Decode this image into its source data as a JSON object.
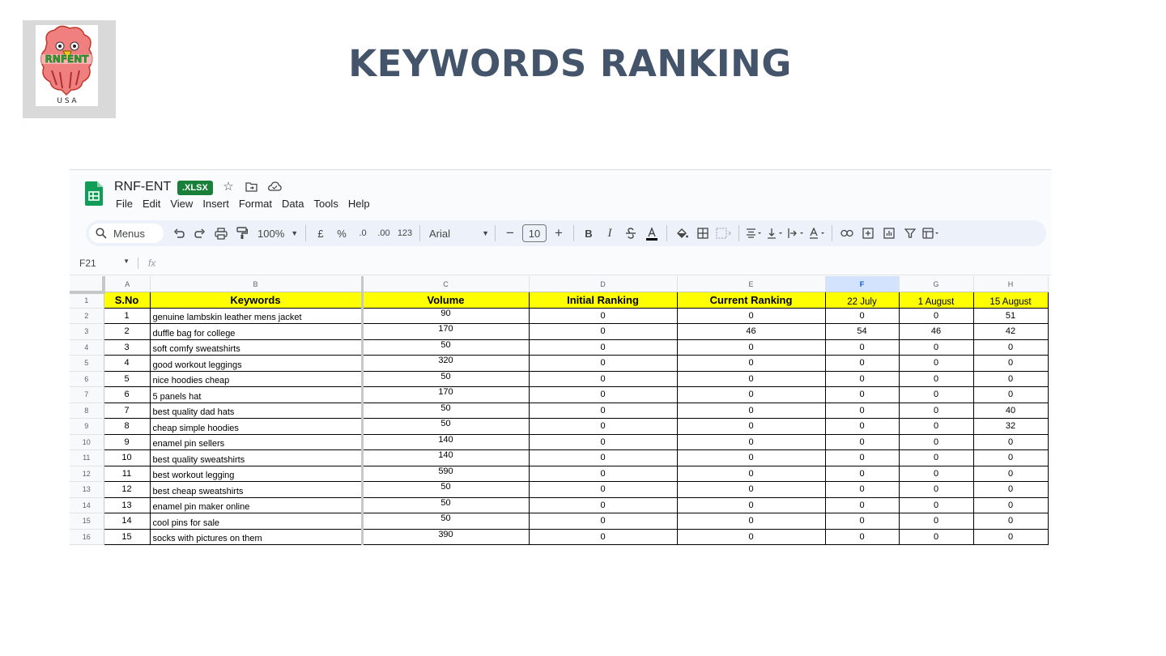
{
  "slide": {
    "title": "KEYWORDS RANKING",
    "logo": {
      "name": "RNFENT",
      "sub": "U S A"
    }
  },
  "app": {
    "doc_title": "RNF-ENT",
    "badge": ".XLSX",
    "menus": [
      "File",
      "Edit",
      "View",
      "Insert",
      "Format",
      "Data",
      "Tools",
      "Help"
    ],
    "toolbar": {
      "search_label": "Menus",
      "zoom": "100%",
      "currency": "£",
      "percent": "%",
      "dec_less": ".0",
      "dec_more": ".00",
      "number_format": "123",
      "font": "Arial",
      "font_size": "10",
      "bold": "B",
      "italic": "I"
    },
    "name_box": "F21",
    "fx_label": "fx"
  },
  "sheet": {
    "col_letters": [
      "A",
      "B",
      "C",
      "D",
      "E",
      "F",
      "G",
      "H"
    ],
    "selected_col": "F",
    "headers": [
      "S.No",
      "Keywords",
      "Volume",
      "Initial Ranking",
      "Current Ranking",
      "22 July",
      "1 August",
      "15 August"
    ],
    "rows": [
      [
        "1",
        "genuine lambskin leather mens jacket",
        "90",
        "0",
        "0",
        "0",
        "0",
        "51"
      ],
      [
        "2",
        "duffle bag for college",
        "170",
        "0",
        "46",
        "54",
        "46",
        "42"
      ],
      [
        "3",
        "soft comfy sweatshirts",
        "50",
        "0",
        "0",
        "0",
        "0",
        "0"
      ],
      [
        "4",
        "good workout leggings",
        "320",
        "0",
        "0",
        "0",
        "0",
        "0"
      ],
      [
        "5",
        "nice hoodies cheap",
        "50",
        "0",
        "0",
        "0",
        "0",
        "0"
      ],
      [
        "6",
        "5 panels hat",
        "170",
        "0",
        "0",
        "0",
        "0",
        "0"
      ],
      [
        "7",
        "best quality dad hats",
        "50",
        "0",
        "0",
        "0",
        "0",
        "40"
      ],
      [
        "8",
        "cheap simple hoodies",
        "50",
        "0",
        "0",
        "0",
        "0",
        "32"
      ],
      [
        "9",
        "enamel pin sellers",
        "140",
        "0",
        "0",
        "0",
        "0",
        "0"
      ],
      [
        "10",
        "best quality sweatshirts",
        "140",
        "0",
        "0",
        "0",
        "0",
        "0"
      ],
      [
        "11",
        "best workout legging",
        "590",
        "0",
        "0",
        "0",
        "0",
        "0"
      ],
      [
        "12",
        "best cheap sweatshirts",
        "50",
        "0",
        "0",
        "0",
        "0",
        "0"
      ],
      [
        "13",
        "enamel pin maker online",
        "50",
        "0",
        "0",
        "0",
        "0",
        "0"
      ],
      [
        "14",
        "cool pins for sale",
        "50",
        "0",
        "0",
        "0",
        "0",
        "0"
      ],
      [
        "15",
        "socks with pictures on them",
        "390",
        "0",
        "0",
        "0",
        "0",
        "0"
      ]
    ]
  }
}
